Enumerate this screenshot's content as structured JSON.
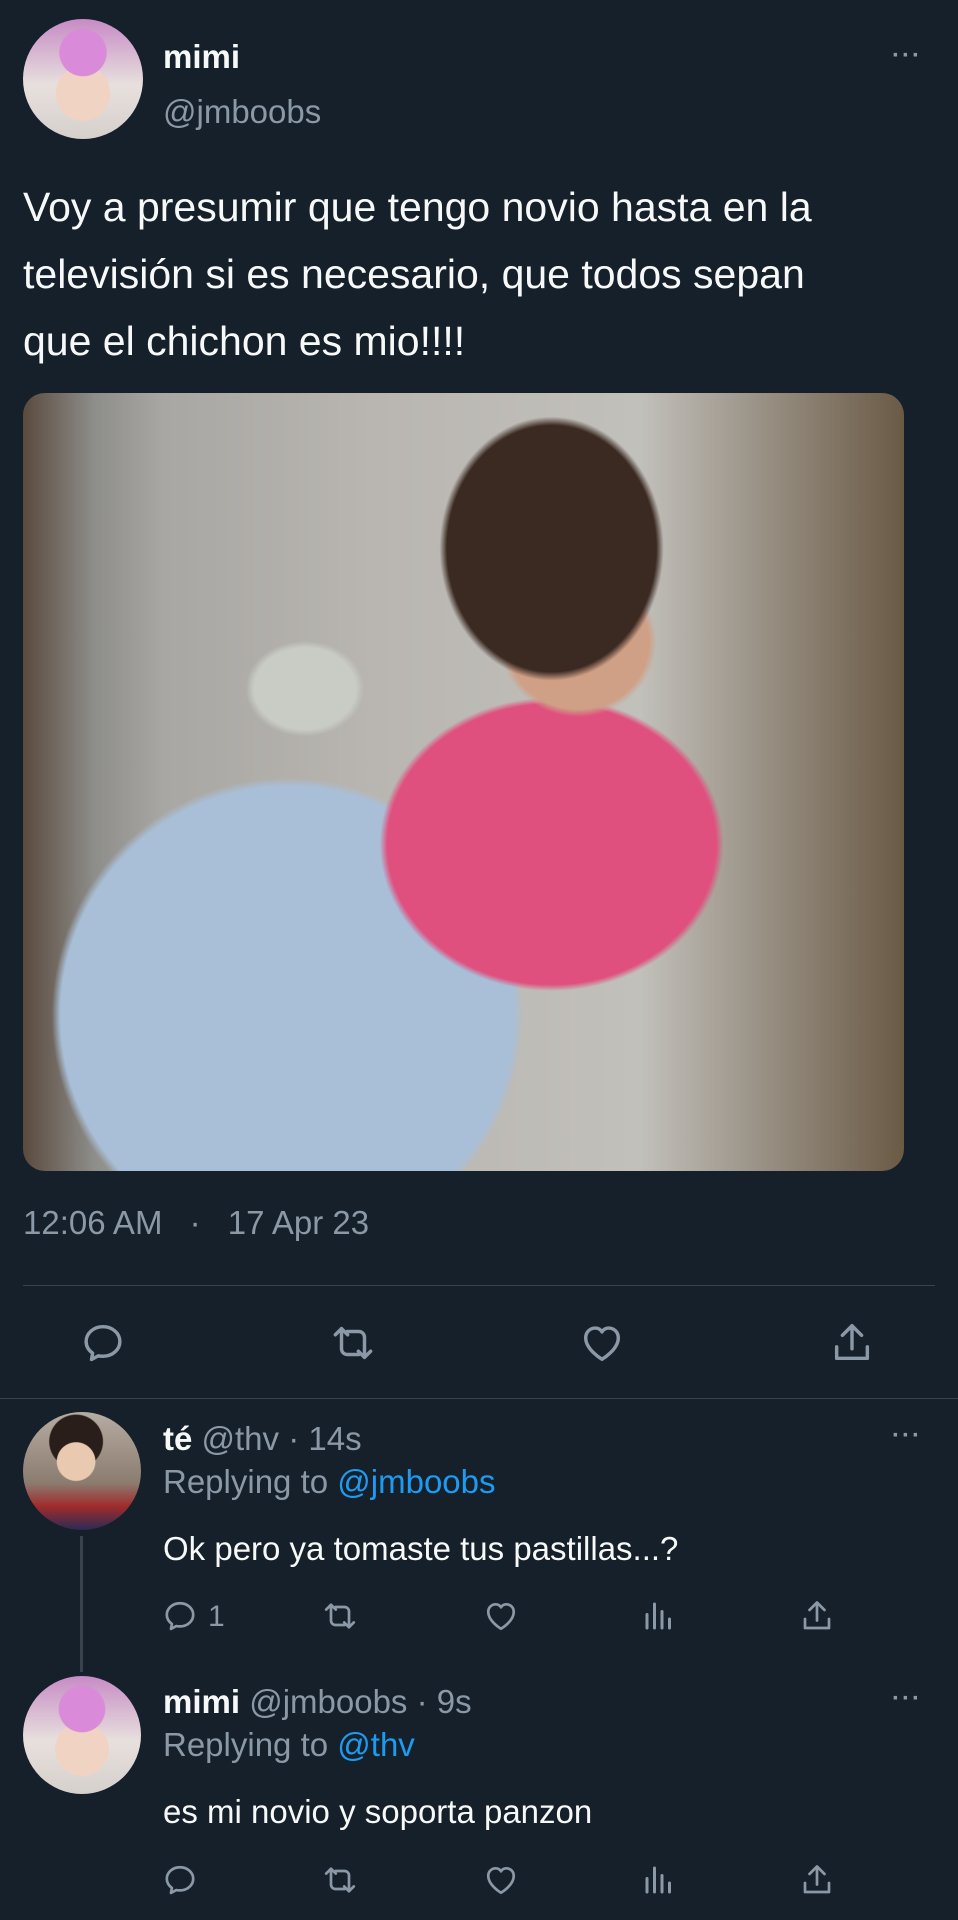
{
  "tweet": {
    "author_name": "mimi",
    "author_handle": "@jmboobs",
    "more": "···",
    "text_line1": "Voy a presumir que tengo novio hasta en la",
    "text_line2": "televisión si es necesario, que todos sepan",
    "text_line3": "que el chichon es mio!!!!",
    "time": "12:06 AM",
    "dot": "·",
    "date": "17 Apr 23"
  },
  "replies": [
    {
      "author_name": "té",
      "author_handle": "@thv",
      "age": "· 14s",
      "replying_prefix": "Replying to",
      "replying_to": "@jmboobs",
      "text": "Ok pero ya tomaste tus pastillas...?",
      "reply_count": "1",
      "more": "···"
    },
    {
      "author_name": "mimi",
      "author_handle": "@jmboobs",
      "age": "· 9s",
      "replying_prefix": "Replying to",
      "replying_to": "@thv",
      "text": "es mi novio y soporta panzon",
      "more": "···"
    }
  ],
  "icons": {
    "reply": "reply-icon",
    "retweet": "retweet-icon",
    "like": "heart-icon",
    "share": "share-icon",
    "views": "views-icon"
  },
  "colors": {
    "background": "#15202b",
    "text": "#f7f9f9",
    "muted": "#8b98a5",
    "link": "#1d9bf0",
    "divider": "#38444d"
  }
}
